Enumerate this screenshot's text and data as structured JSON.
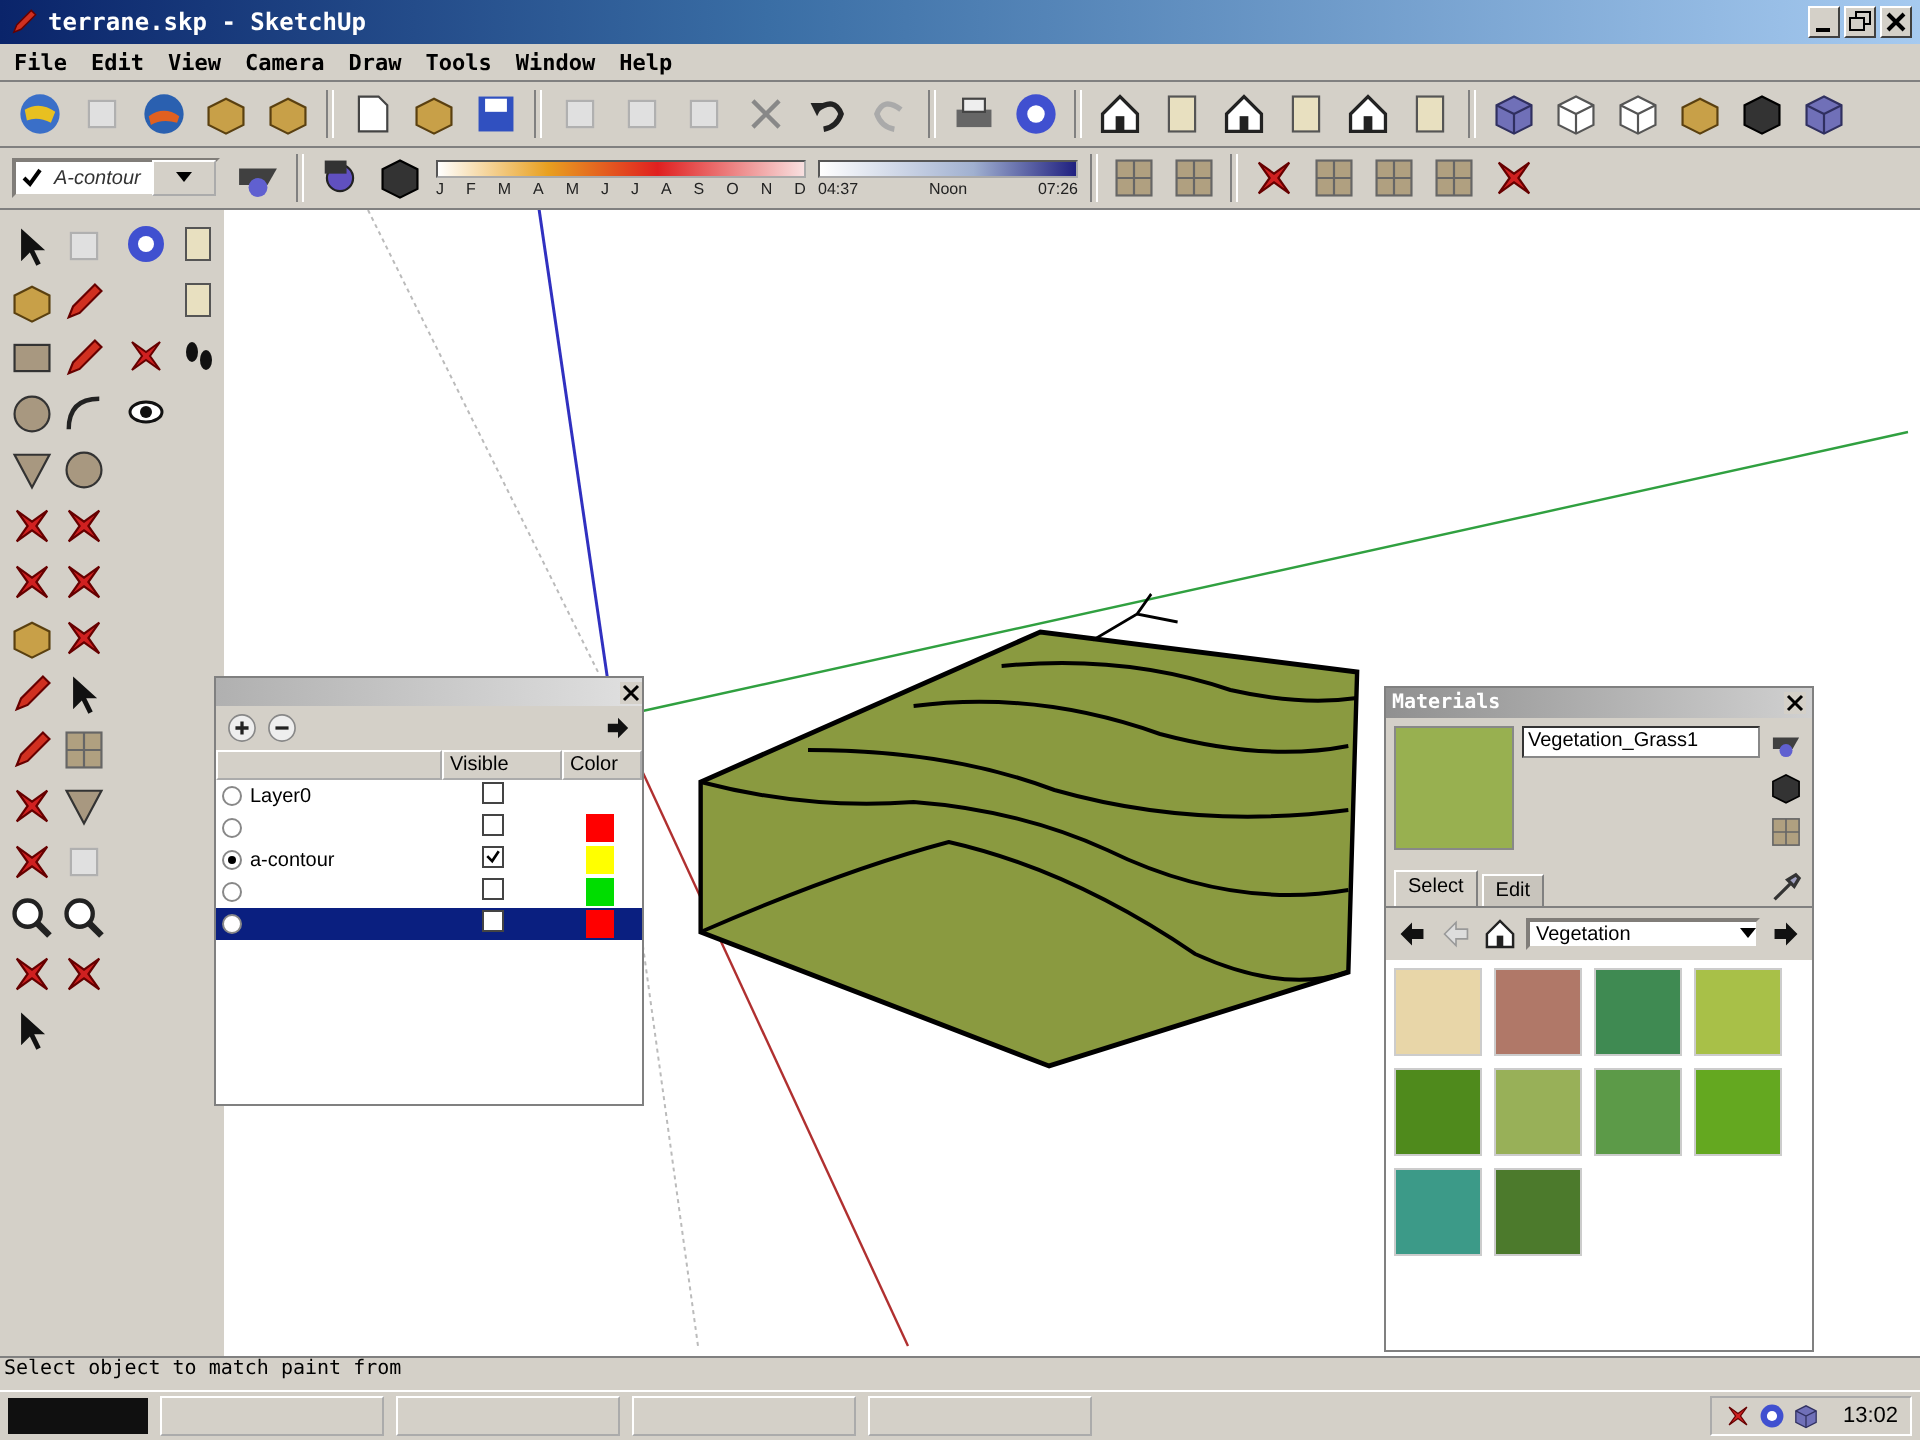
{
  "window": {
    "title": "terrane.skp - SketchUp"
  },
  "menu": [
    "File",
    "Edit",
    "View",
    "Camera",
    "Draw",
    "Tools",
    "Window",
    "Help"
  ],
  "layer_dropdown": {
    "value": "A-contour"
  },
  "shadow_settings": {
    "months": [
      "J",
      "F",
      "M",
      "A",
      "M",
      "J",
      "J",
      "A",
      "S",
      "O",
      "N",
      "D"
    ],
    "time_labels": [
      "04:37",
      "Noon",
      "07:26"
    ]
  },
  "layers_panel": {
    "columns": [
      "Visible",
      "Color"
    ],
    "layers": [
      {
        "name": "Layer0",
        "current": false,
        "visible": false,
        "selected": false
      },
      {
        "current": false,
        "visible": false,
        "color": "#ff0000",
        "selected": false
      },
      {
        "name": "a-contour",
        "current": true,
        "visible": true,
        "color": "#ffff00",
        "selected": false
      },
      {
        "current": false,
        "visible": false,
        "color": "#00dd00",
        "selected": false
      },
      {
        "current": false,
        "visible": false,
        "color": "#ff0000",
        "selected": true
      }
    ]
  },
  "materials_panel": {
    "title": "Materials",
    "material_name": "Vegetation_Grass1",
    "tabs": [
      {
        "label": "Select",
        "selected": true
      },
      {
        "label": "Edit",
        "selected": false
      }
    ],
    "collection": "Vegetation",
    "swatches": [
      {
        "color": "#e8d6a8"
      },
      {
        "color": "#b07868"
      },
      {
        "color": "#3f8a52"
      },
      {
        "color": "#a8c048"
      },
      {
        "color": "#4f8a1c"
      },
      {
        "color": "#98b058"
      },
      {
        "color": "#5c9a48"
      },
      {
        "color": "#64a820"
      },
      {
        "color": "#3c9a88"
      },
      {
        "color": "#4c7a2c"
      }
    ]
  },
  "status_bar": {
    "text": "Select object to match paint from"
  },
  "taskbar": {
    "clock": "13:02"
  }
}
